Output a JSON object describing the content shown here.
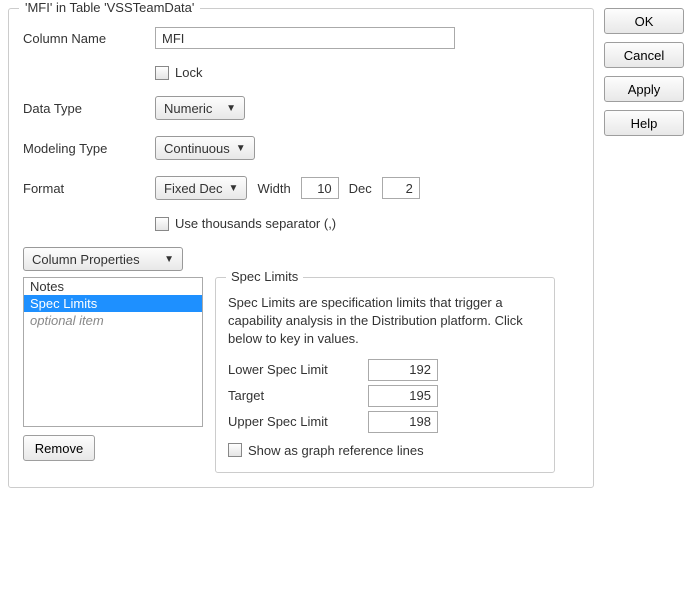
{
  "buttons": {
    "ok": "OK",
    "cancel": "Cancel",
    "apply": "Apply",
    "help": "Help",
    "remove": "Remove"
  },
  "group_title": "'MFI' in Table 'VSSTeamData'",
  "labels": {
    "column_name": "Column Name",
    "lock": "Lock",
    "data_type": "Data Type",
    "modeling_type": "Modeling Type",
    "format": "Format",
    "width": "Width",
    "dec": "Dec",
    "thousands": "Use thousands separator (,)"
  },
  "values": {
    "column_name": "MFI",
    "data_type": "Numeric",
    "modeling_type": "Continuous",
    "format": "Fixed Dec",
    "width": "10",
    "dec": "2"
  },
  "column_properties": {
    "button_label": "Column Properties",
    "items": [
      "Notes",
      "Spec Limits",
      "optional item"
    ],
    "selected_index": 1
  },
  "spec_limits": {
    "title": "Spec Limits",
    "description": "Spec Limits are specification limits that trigger a capability analysis in the Distribution platform. Click below to key in values.",
    "rows": {
      "lower_label": "Lower Spec Limit",
      "lower_value": "192",
      "target_label": "Target",
      "target_value": "195",
      "upper_label": "Upper Spec Limit",
      "upper_value": "198"
    },
    "show_ref_label": "Show as graph reference lines"
  }
}
